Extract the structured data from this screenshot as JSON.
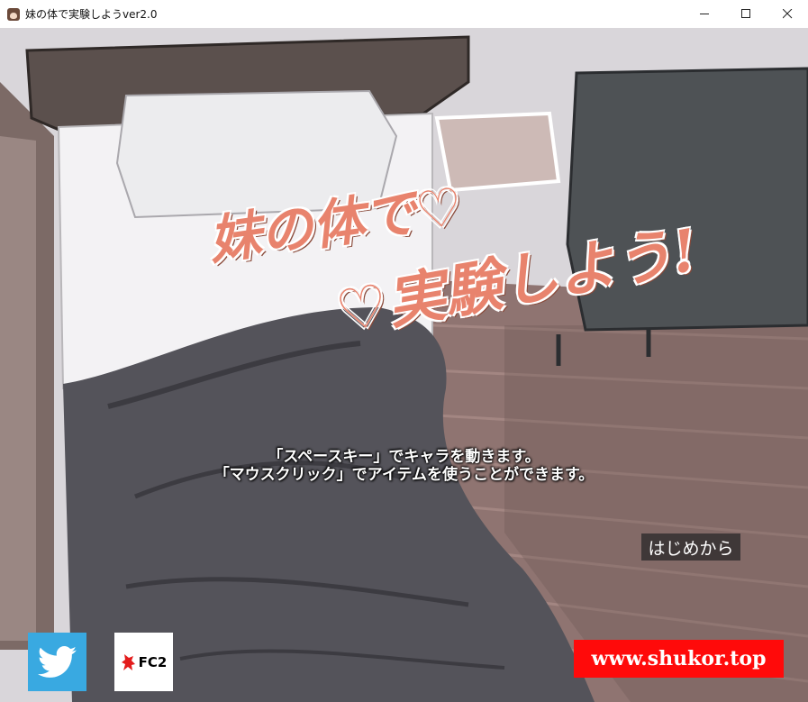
{
  "window": {
    "title": "妹の体で実験しようver2.0",
    "minimize_glyph": "—",
    "maximize_glyph": "☐",
    "close_glyph": "✕"
  },
  "game": {
    "logo_line1": "妹の体で♡",
    "logo_line2": "♡実験しよう!",
    "instruction_1": "「スペースキー」でキャラを動きます。",
    "instruction_2": "「マウスクリック」でアイテムを使うことができます。",
    "start_button": "はじめから"
  },
  "links": {
    "twitter_icon": "twitter-bird",
    "fc2_label": "FC2",
    "site_url": "www.shukor.top"
  },
  "colors": {
    "twitter_blue": "#39a9e1",
    "site_red": "#ff0a0a",
    "logo_pink": "#e8836d"
  }
}
